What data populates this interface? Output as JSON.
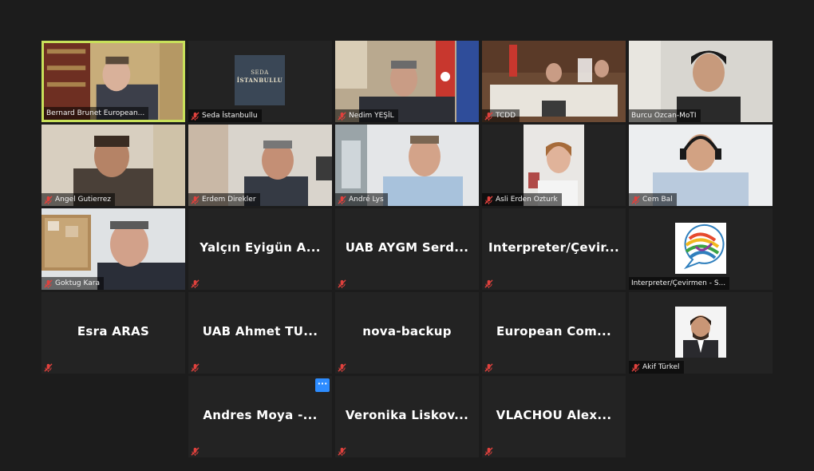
{
  "tiles": [
    {
      "name": "Bernard Brunet European...",
      "type": "video",
      "active": true
    },
    {
      "name": "Seda İstanbullu",
      "type": "logo",
      "logo_lines": [
        "SEDA",
        "İSTANBULLU"
      ]
    },
    {
      "name": "Nedim YEŞİL",
      "type": "video"
    },
    {
      "name": "TCDD",
      "type": "video"
    },
    {
      "name": "Burcu Ozcan-MoTI",
      "type": "video"
    },
    {
      "name": "Angel Gutierrez",
      "type": "video"
    },
    {
      "name": "Erdem Direkler",
      "type": "video"
    },
    {
      "name": "André Lys",
      "type": "video"
    },
    {
      "name": "Asli Erden Ozturk",
      "type": "video"
    },
    {
      "name": "Cem Bal",
      "type": "video"
    },
    {
      "name": "Goktug Kara",
      "type": "video"
    },
    {
      "name": "Yalçın Eyigün A...",
      "type": "text"
    },
    {
      "name": "UAB AYGM Serd...",
      "type": "text"
    },
    {
      "name": "Interpreter/Çevir...",
      "type": "text"
    },
    {
      "name": "Interpreter/Çevirmen - S...",
      "type": "wto"
    },
    {
      "name": "Esra ARAS",
      "type": "text"
    },
    {
      "name": "UAB Ahmet TU...",
      "type": "text"
    },
    {
      "name": "nova-backup",
      "type": "text"
    },
    {
      "name": "European Com...",
      "type": "text"
    },
    {
      "name": "Akif Türkel",
      "type": "photo"
    },
    {
      "name": "Andres Moya -...",
      "type": "text"
    },
    {
      "name": "Veronika Liskov...",
      "type": "text"
    },
    {
      "name": "VLACHOU Alex...",
      "type": "text"
    }
  ],
  "menu_button": {
    "label": "···"
  },
  "colors": {
    "active_border": "#c8e05a",
    "muted_icon": "#e0413d",
    "menu": "#2d8cff"
  }
}
